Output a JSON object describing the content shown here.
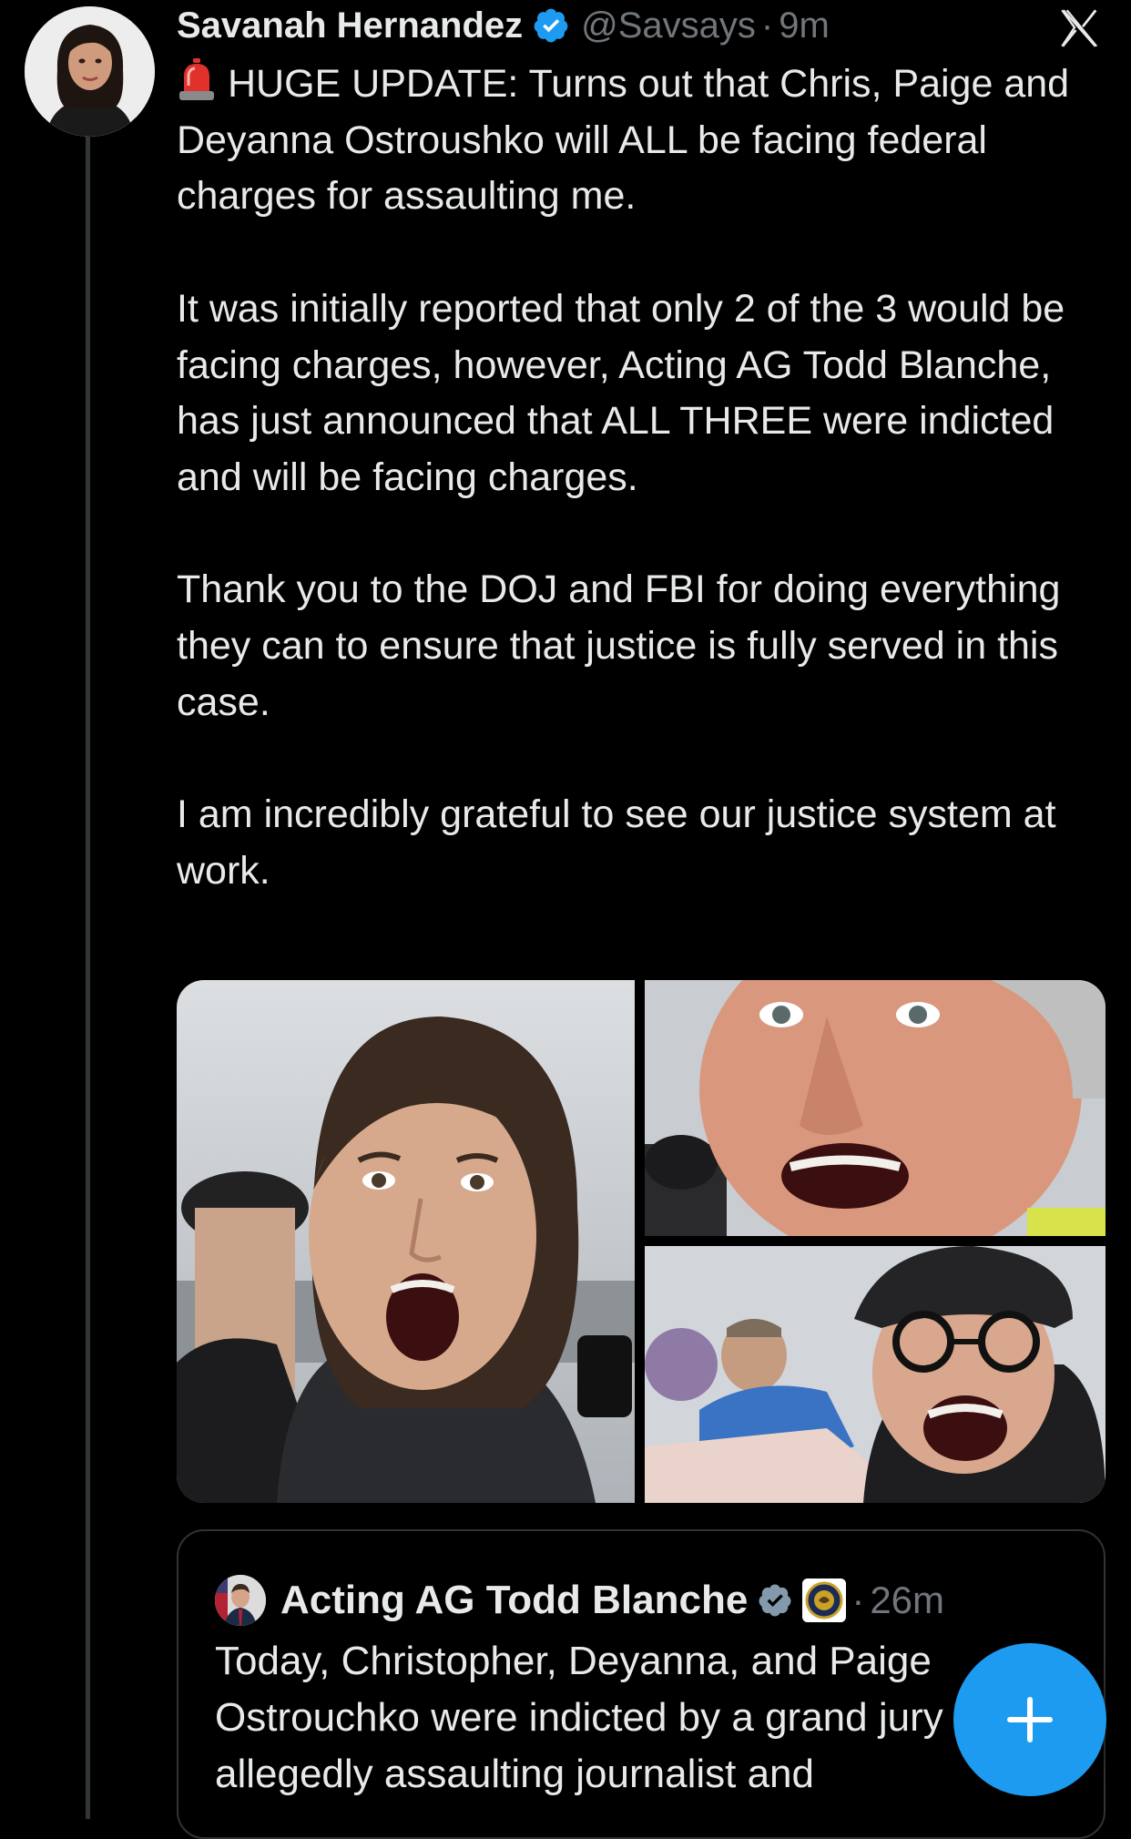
{
  "tweet": {
    "author_name": "Savanah Hernandez",
    "handle": "@Savsays",
    "separator": "·",
    "time": "9m",
    "paragraphs": [
      "HUGE UPDATE: Turns out that Chris, Paige and Deyanna Ostroushko will ALL be facing federal charges for assaulting me.",
      "It was initially reported that only 2 of the 3 would be facing charges, however, Acting AG Todd Blanche, has just announced that ALL THREE were indicted and will be facing charges.",
      "Thank you to the DOJ and FBI for doing everything they can to ensure that justice is fully served in this case.",
      "I am incredibly grateful to see our justice system at work."
    ],
    "lead_icon": "rotating-light-icon",
    "verified_icon": "verified-badge-icon"
  },
  "media": {
    "photos": [
      {
        "name": "photo-woman-shouting"
      },
      {
        "name": "photo-man-shouting"
      },
      {
        "name": "photo-woman-glasses-shouting"
      }
    ]
  },
  "quote": {
    "author_name": "Acting AG Todd Blanche",
    "separator": "·",
    "time": "26m",
    "text": "Today, Christopher, Deyanna, and Paige Ostrouchko were indicted by a grand jury for allegedly assaulting journalist and",
    "affiliation_icon": "doj-seal-icon"
  },
  "chrome": {
    "x_logo": "x-logo-icon",
    "compose_button": "+",
    "colors": {
      "background": "#000000",
      "text": "#e7e9ea",
      "muted": "#71767b",
      "accent": "#1d9bf0",
      "border": "#2f3336"
    }
  }
}
